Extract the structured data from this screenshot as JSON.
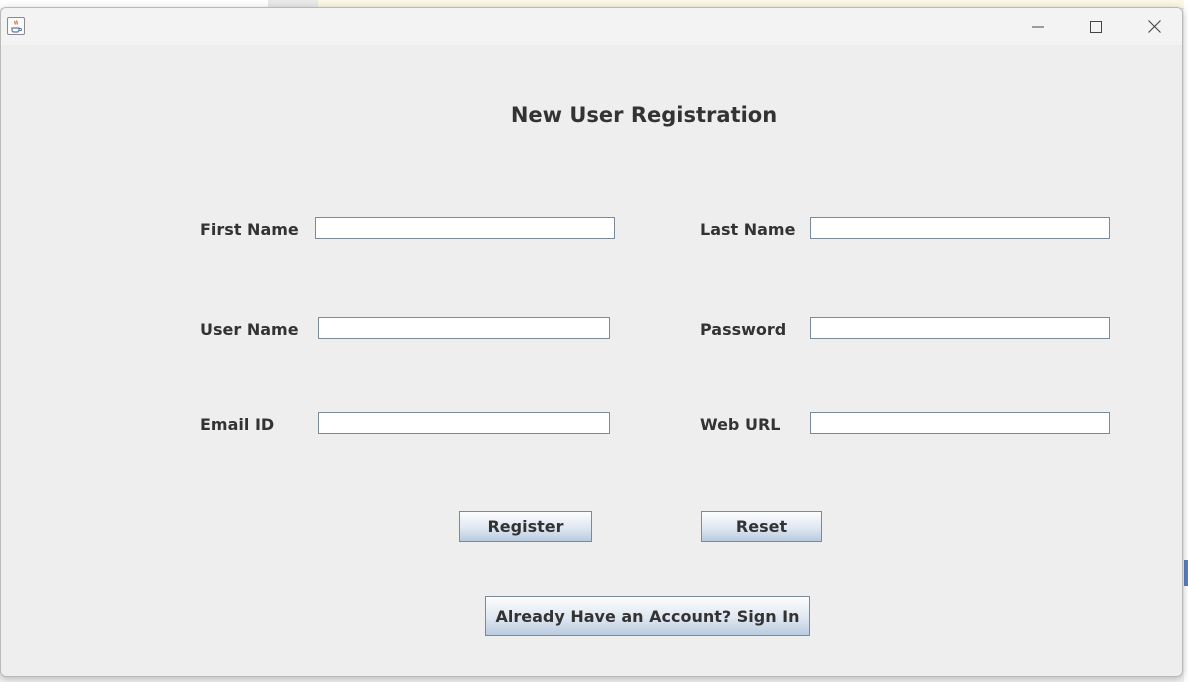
{
  "window": {
    "icon": "java-icon",
    "controls": [
      "minimize-icon",
      "maximize-icon",
      "close-icon"
    ]
  },
  "form": {
    "title": "New User Registration",
    "fields": {
      "first_name": {
        "label": "First Name",
        "value": ""
      },
      "last_name": {
        "label": "Last Name",
        "value": ""
      },
      "user_name": {
        "label": "User Name",
        "value": ""
      },
      "password": {
        "label": "Password",
        "value": ""
      },
      "email": {
        "label": "Email ID",
        "value": ""
      },
      "web_url": {
        "label": "Web URL",
        "value": ""
      }
    },
    "buttons": {
      "register": "Register",
      "reset": "Reset",
      "sign_in": "Already Have an Account? Sign In"
    }
  },
  "colors": {
    "window_bg": "#eeeeee",
    "text": "#333333",
    "button_gradient_end": "#b9cbe0"
  }
}
